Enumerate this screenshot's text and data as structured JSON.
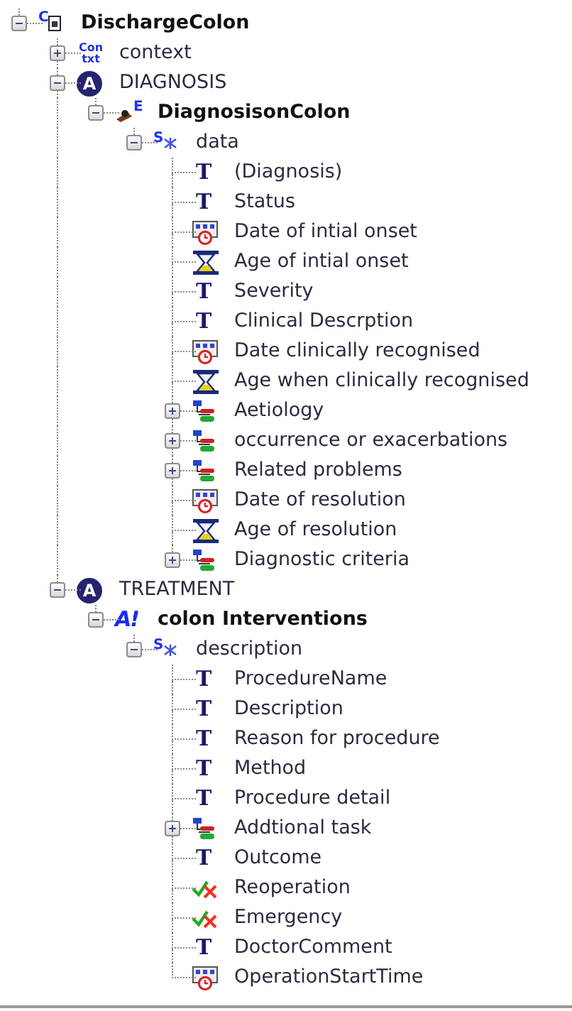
{
  "tree": [
    {
      "label": "DischargeColon",
      "kind": "composition",
      "glyph": "C",
      "expanded": true,
      "children": [
        {
          "label": "context",
          "kind": "context",
          "glyph": "Con txt",
          "expanded": false
        },
        {
          "label": "DIAGNOSIS",
          "kind": "section",
          "glyph": "A",
          "expanded": true,
          "children": [
            {
              "label": "DiagnosisonColon",
              "kind": "entry",
              "glyph": "E",
              "expanded": true,
              "children": [
                {
                  "label": "data",
                  "kind": "structure",
                  "glyph": "S",
                  "expanded": true,
                  "children": [
                    {
                      "label": "(Diagnosis)",
                      "kind": "text",
                      "glyph": "T"
                    },
                    {
                      "label": "Status",
                      "kind": "text",
                      "glyph": "T"
                    },
                    {
                      "label": "Date of intial onset",
                      "kind": "datetime"
                    },
                    {
                      "label": "Age of intial onset",
                      "kind": "quantity"
                    },
                    {
                      "label": "Severity",
                      "kind": "text",
                      "glyph": "T"
                    },
                    {
                      "label": "Clinical Descrption",
                      "kind": "text",
                      "glyph": "T"
                    },
                    {
                      "label": "Date clinically recognised",
                      "kind": "datetime"
                    },
                    {
                      "label": "Age when clinically recognised",
                      "kind": "quantity"
                    },
                    {
                      "label": "Aetiology",
                      "kind": "cluster",
                      "expanded": false
                    },
                    {
                      "label": "occurrence or exacerbations",
                      "kind": "cluster",
                      "expanded": false
                    },
                    {
                      "label": "Related problems",
                      "kind": "cluster",
                      "expanded": false
                    },
                    {
                      "label": "Date of resolution",
                      "kind": "datetime"
                    },
                    {
                      "label": "Age of resolution",
                      "kind": "quantity"
                    },
                    {
                      "label": "Diagnostic criteria",
                      "kind": "cluster",
                      "expanded": false
                    }
                  ]
                }
              ]
            }
          ]
        },
        {
          "label": "TREATMENT",
          "kind": "section",
          "glyph": "A",
          "expanded": true,
          "children": [
            {
              "label": "colon Interventions",
              "kind": "action",
              "glyph": "A!",
              "expanded": true,
              "children": [
                {
                  "label": "description",
                  "kind": "structure",
                  "glyph": "S",
                  "expanded": true,
                  "children": [
                    {
                      "label": "ProcedureName",
                      "kind": "text",
                      "glyph": "T"
                    },
                    {
                      "label": "Description",
                      "kind": "text",
                      "glyph": "T"
                    },
                    {
                      "label": "Reason for procedure",
                      "kind": "text",
                      "glyph": "T"
                    },
                    {
                      "label": "Method",
                      "kind": "text",
                      "glyph": "T"
                    },
                    {
                      "label": "Procedure detail",
                      "kind": "text",
                      "glyph": "T"
                    },
                    {
                      "label": "Addtional task",
                      "kind": "cluster",
                      "expanded": false
                    },
                    {
                      "label": "Outcome",
                      "kind": "text",
                      "glyph": "T"
                    },
                    {
                      "label": "Reoperation",
                      "kind": "boolean"
                    },
                    {
                      "label": "Emergency",
                      "kind": "boolean"
                    },
                    {
                      "label": "DoctorComment",
                      "kind": "text",
                      "glyph": "T"
                    },
                    {
                      "label": "OperationStartTime",
                      "kind": "datetime"
                    }
                  ]
                }
              ]
            }
          ]
        }
      ]
    }
  ]
}
